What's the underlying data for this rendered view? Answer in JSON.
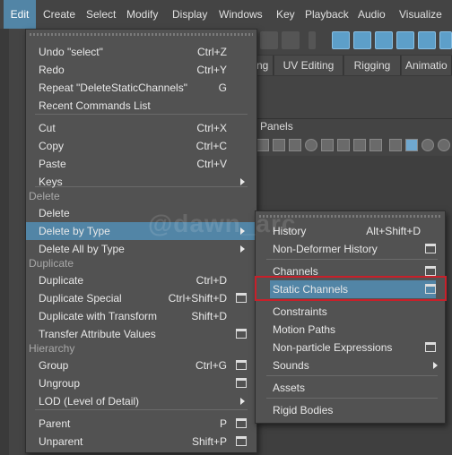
{
  "menubar": [
    "Edit",
    "Create",
    "Select",
    "Modify",
    "Display",
    "Windows",
    "Key",
    "Playback",
    "Audio",
    "Visualize"
  ],
  "shelf_tabs": [
    "ng",
    "UV Editing",
    "Rigging",
    "Animatio"
  ],
  "panels_label": "Panels",
  "watermark": "@dawn_arc",
  "edit_menu": {
    "items": [
      {
        "label": "Undo \"select\"",
        "shortcut": "Ctrl+Z"
      },
      {
        "label": "Redo",
        "shortcut": "Ctrl+Y"
      },
      {
        "label": "Repeat \"DeleteStaticChannels\"",
        "shortcut": "G"
      },
      {
        "label": "Recent Commands List",
        "shortcut": ""
      },
      {
        "label": "Cut",
        "shortcut": "Ctrl+X"
      },
      {
        "label": "Copy",
        "shortcut": "Ctrl+C"
      },
      {
        "label": "Paste",
        "shortcut": "Ctrl+V"
      },
      {
        "label": "Keys",
        "shortcut": ""
      },
      {
        "section": "Delete"
      },
      {
        "label": "Delete",
        "shortcut": ""
      },
      {
        "label": "Delete by Type",
        "shortcut": ""
      },
      {
        "label": "Delete All by Type",
        "shortcut": ""
      },
      {
        "section": "Duplicate"
      },
      {
        "label": "Duplicate",
        "shortcut": "Ctrl+D"
      },
      {
        "label": "Duplicate Special",
        "shortcut": "Ctrl+Shift+D"
      },
      {
        "label": "Duplicate with Transform",
        "shortcut": "Shift+D"
      },
      {
        "label": "Transfer Attribute Values",
        "shortcut": ""
      },
      {
        "section": "Hierarchy"
      },
      {
        "label": "Group",
        "shortcut": "Ctrl+G"
      },
      {
        "label": "Ungroup",
        "shortcut": ""
      },
      {
        "label": "LOD (Level of Detail)",
        "shortcut": ""
      },
      {
        "label": "Parent",
        "shortcut": "P"
      },
      {
        "label": "Unparent",
        "shortcut": "Shift+P"
      }
    ]
  },
  "submenu": {
    "items": [
      {
        "label": "History",
        "shortcut": "Alt+Shift+D"
      },
      {
        "label": "Non-Deformer History",
        "shortcut": ""
      },
      {
        "label": "Channels",
        "shortcut": ""
      },
      {
        "label": "Static Channels",
        "shortcut": ""
      },
      {
        "label": "Constraints",
        "shortcut": ""
      },
      {
        "label": "Motion Paths",
        "shortcut": ""
      },
      {
        "label": "Non-particle Expressions",
        "shortcut": ""
      },
      {
        "label": "Sounds",
        "shortcut": ""
      },
      {
        "label": "Assets",
        "shortcut": ""
      },
      {
        "label": "Rigid Bodies",
        "shortcut": ""
      }
    ]
  },
  "colors": {
    "highlight": "#5285a6",
    "menu_bg": "#525252",
    "app_bg": "#444444",
    "annotation_box": "#c8202a"
  }
}
